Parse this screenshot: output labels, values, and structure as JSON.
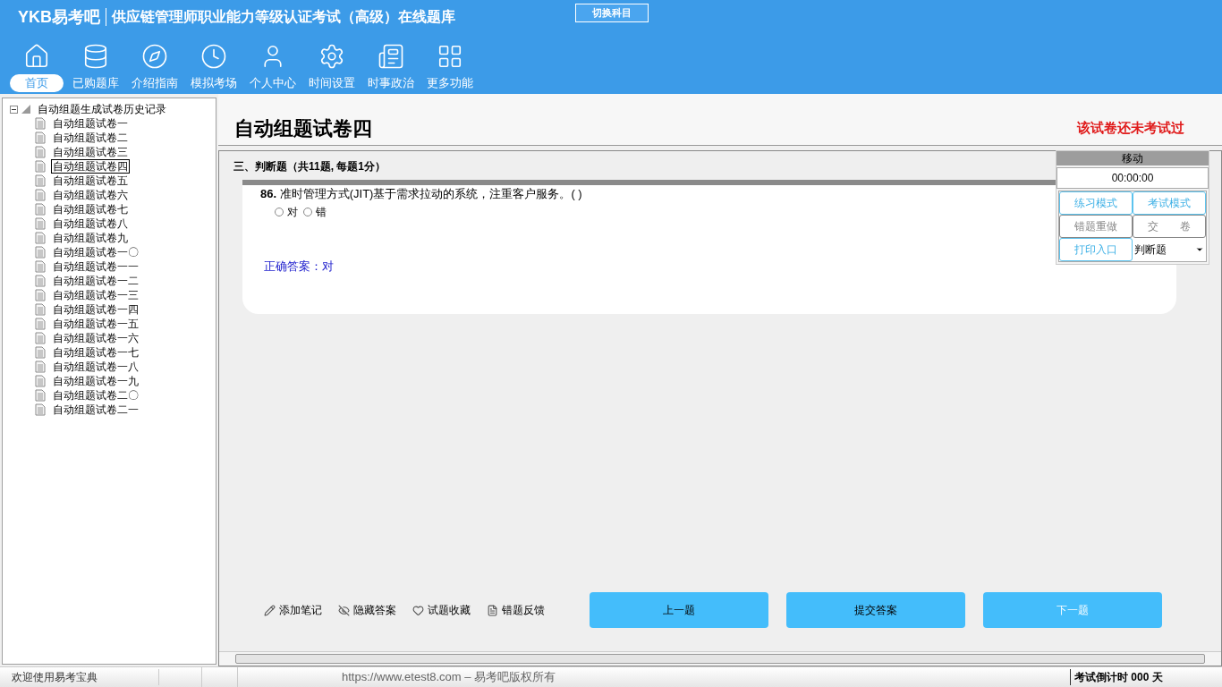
{
  "header": {
    "logo": "YKB易考吧",
    "title": "供应链管理师职业能力等级认证考试（高级）在线题库",
    "switch_button": "切换科目"
  },
  "nav": [
    {
      "label": "首页",
      "selected": true
    },
    {
      "label": "已购题库",
      "selected": false
    },
    {
      "label": "介绍指南",
      "selected": false
    },
    {
      "label": "模拟考场",
      "selected": false
    },
    {
      "label": "个人中心",
      "selected": false
    },
    {
      "label": "时间设置",
      "selected": false
    },
    {
      "label": "时事政治",
      "selected": false
    },
    {
      "label": "更多功能",
      "selected": false
    }
  ],
  "tree": {
    "label": "自动组题生成试卷历史记录",
    "expanded": true,
    "children": [
      {
        "label": "自动组题试卷一",
        "selected": false
      },
      {
        "label": "自动组题试卷二",
        "selected": false
      },
      {
        "label": "自动组题试卷三",
        "selected": false
      },
      {
        "label": "自动组题试卷四",
        "selected": true
      },
      {
        "label": "自动组题试卷五",
        "selected": false
      },
      {
        "label": "自动组题试卷六",
        "selected": false
      },
      {
        "label": "自动组题试卷七",
        "selected": false
      },
      {
        "label": "自动组题试卷八",
        "selected": false
      },
      {
        "label": "自动组题试卷九",
        "selected": false
      },
      {
        "label": "自动组题试卷一〇",
        "selected": false
      },
      {
        "label": "自动组题试卷一一",
        "selected": false
      },
      {
        "label": "自动组题试卷一二",
        "selected": false
      },
      {
        "label": "自动组题试卷一三",
        "selected": false
      },
      {
        "label": "自动组题试卷一四",
        "selected": false
      },
      {
        "label": "自动组题试卷一五",
        "selected": false
      },
      {
        "label": "自动组题试卷一六",
        "selected": false
      },
      {
        "label": "自动组题试卷一七",
        "selected": false
      },
      {
        "label": "自动组题试卷一八",
        "selected": false
      },
      {
        "label": "自动组题试卷一九",
        "selected": false
      },
      {
        "label": "自动组题试卷二〇",
        "selected": false
      },
      {
        "label": "自动组题试卷二一",
        "selected": false
      }
    ]
  },
  "paper": {
    "title": "自动组题试卷四",
    "status": "该试卷还未考试过",
    "section": "三、判断题（共11题, 每题1分）",
    "question": {
      "number": "86.",
      "text": "准时管理方式(JIT)基于需求拉动的系统，注重客户服务。( )",
      "options": [
        {
          "label": "对",
          "checked": false
        },
        {
          "label": "错",
          "checked": false
        }
      ],
      "answer": "正确答案：对"
    }
  },
  "widget": {
    "title": "移动",
    "timer": "00:00:00",
    "buttons": [
      {
        "label": "练习模式",
        "disabled": false
      },
      {
        "label": "考试模式",
        "disabled": false
      },
      {
        "label": "错题重做",
        "disabled": true
      },
      {
        "label": "交　　卷",
        "disabled": true
      },
      {
        "label": "打印入口",
        "disabled": false
      }
    ],
    "type_select": "判断题"
  },
  "actions": [
    "添加笔记",
    "隐藏答案",
    "试题收藏",
    "错题反馈"
  ],
  "nav_buttons": [
    {
      "label": "上一题",
      "disabled": false
    },
    {
      "label": "提交答案",
      "disabled": false
    },
    {
      "label": "下一题",
      "disabled": true
    }
  ],
  "status_bar": {
    "welcome": "欢迎使用易考宝典",
    "copyright": "https://www.etest8.com – 易考吧版权所有",
    "countdown": "考试倒计时 000 天"
  }
}
